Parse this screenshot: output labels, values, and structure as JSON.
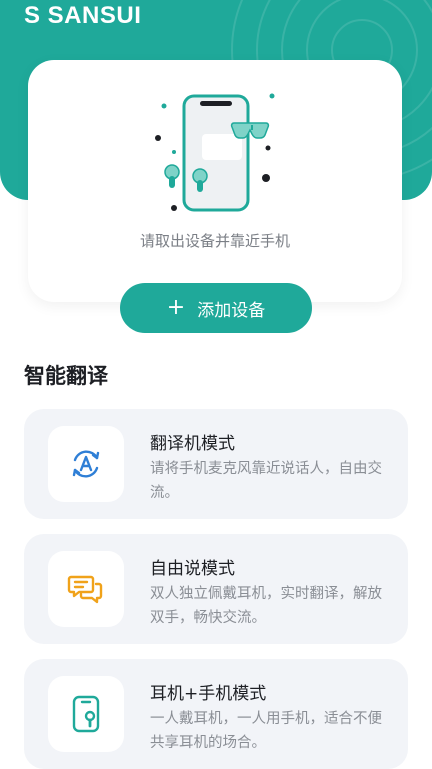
{
  "brand": "S SANSUI",
  "colors": {
    "accent": "#1fa99a",
    "card": "#f2f4f8",
    "translate_icon": "#2f7fd6",
    "chat_icon": "#f0a21a",
    "phone_icon": "#1fa99a"
  },
  "device_card": {
    "hint": "请取出设备并靠近手机"
  },
  "add_button": {
    "icon": "plus-icon",
    "label": "添加设备"
  },
  "section": {
    "title": "智能翻译"
  },
  "modes": [
    {
      "icon": "translate-icon",
      "title": "翻译机模式",
      "desc": "请将手机麦克风靠近说话人，自由交流。"
    },
    {
      "icon": "chat-icon",
      "title": "自由说模式",
      "desc": "双人独立佩戴耳机，实时翻译，解放双手，畅快交流。"
    },
    {
      "icon": "phone-earbud-icon",
      "title": "耳机+手机模式",
      "desc": "一人戴耳机，一人用手机，适合不便共享耳机的场合。"
    }
  ]
}
